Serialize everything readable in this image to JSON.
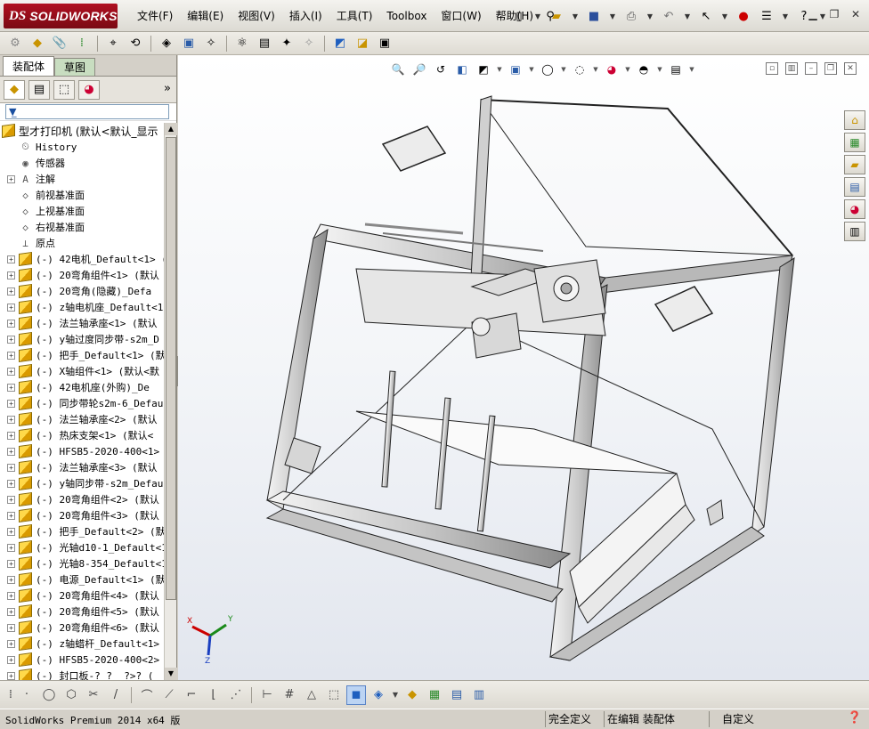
{
  "app": {
    "logo_ds": "DS",
    "logo_text": "SOLIDWORKS"
  },
  "menu": [
    "文件(F)",
    "编辑(E)",
    "视图(V)",
    "插入(I)",
    "工具(T)",
    "Toolbox",
    "窗口(W)",
    "帮助(H)"
  ],
  "feature_manager": {
    "tabs": [
      "装配体",
      "草图"
    ],
    "filter_icon": "filter-icon",
    "root": "型才打印机   (默认<默认_显示",
    "items": [
      {
        "label": "History",
        "icon": "history-icon",
        "expandable": false
      },
      {
        "label": "传感器",
        "icon": "sensor-icon",
        "expandable": false
      },
      {
        "label": "注解",
        "icon": "annotation-icon",
        "expandable": true
      },
      {
        "label": "前视基准面",
        "icon": "plane-icon",
        "expandable": false
      },
      {
        "label": "上视基准面",
        "icon": "plane-icon",
        "expandable": false
      },
      {
        "label": "右视基准面",
        "icon": "plane-icon",
        "expandable": false
      },
      {
        "label": "原点",
        "icon": "origin-icon",
        "expandable": false
      },
      {
        "label": "(-) 42电机_Default<1> (",
        "icon": "part-icon",
        "expandable": true
      },
      {
        "label": "(-) 20弯角组件<1> (默认",
        "icon": "part-icon",
        "expandable": true
      },
      {
        "label": "(-) 20弯角(隐藏)_Defa",
        "icon": "part-icon",
        "expandable": true
      },
      {
        "label": "(-) z轴电机座_Default<1",
        "icon": "part-icon",
        "expandable": true
      },
      {
        "label": "(-) 法兰轴承座<1> (默认",
        "icon": "part-icon",
        "expandable": true
      },
      {
        "label": "(-) y轴过度同步带-s2m_D",
        "icon": "part-icon",
        "expandable": true
      },
      {
        "label": "(-) 把手_Default<1> (默",
        "icon": "part-icon",
        "expandable": true
      },
      {
        "label": "(-) X轴组件<1> (默认<默",
        "icon": "part-icon",
        "expandable": true
      },
      {
        "label": "(-) 42电机座(外购)_De",
        "icon": "part-icon",
        "expandable": true
      },
      {
        "label": "(-) 同步带轮s2m-6_Defau",
        "icon": "part-icon",
        "expandable": true
      },
      {
        "label": "(-) 法兰轴承座<2> (默认",
        "icon": "part-icon",
        "expandable": true
      },
      {
        "label": "(-) 热床支架<1> (默认<",
        "icon": "part-icon",
        "expandable": true
      },
      {
        "label": "(-) HFSB5-2020-400<1> (",
        "icon": "part-icon",
        "expandable": true
      },
      {
        "label": "(-) 法兰轴承座<3> (默认",
        "icon": "part-icon",
        "expandable": true
      },
      {
        "label": "(-) y轴同步带-s2m_Defau",
        "icon": "part-icon",
        "expandable": true
      },
      {
        "label": "(-) 20弯角组件<2> (默认",
        "icon": "part-icon",
        "expandable": true
      },
      {
        "label": "(-) 20弯角组件<3> (默认",
        "icon": "part-icon",
        "expandable": true
      },
      {
        "label": "(-) 把手_Default<2> (默",
        "icon": "part-icon",
        "expandable": true
      },
      {
        "label": "(-) 光轴d10-1_Default<1",
        "icon": "part-icon",
        "expandable": true
      },
      {
        "label": "(-) 光轴8-354_Default<1",
        "icon": "part-icon",
        "expandable": true
      },
      {
        "label": "(-) 电源_Default<1> (默",
        "icon": "part-icon",
        "expandable": true
      },
      {
        "label": "(-) 20弯角组件<4> (默认",
        "icon": "part-icon",
        "expandable": true
      },
      {
        "label": "(-) 20弯角组件<5> (默认",
        "icon": "part-icon",
        "expandable": true
      },
      {
        "label": "(-) 20弯角组件<6> (默认",
        "icon": "part-icon",
        "expandable": true
      },
      {
        "label": "(-) z轴蜡杆_Default<1>",
        "icon": "part-icon",
        "expandable": true
      },
      {
        "label": "(-) HFSB5-2020-400<2> (",
        "icon": "part-icon",
        "expandable": true
      },
      {
        "label": "(-) 封口板-? ?_ ?>? (",
        "icon": "part-icon",
        "expandable": true
      }
    ]
  },
  "triad": {
    "x": "X",
    "y": "Y",
    "z": "Z"
  },
  "status": {
    "app": "SolidWorks Premium 2014 x64 版",
    "defined": "完全定义",
    "editing": "在编辑 装配体",
    "units": "自定义"
  },
  "colors": {
    "logo_red": "#a0101c",
    "viewport_top": "#ffffff",
    "viewport_bottom": "#e2e6ee"
  }
}
